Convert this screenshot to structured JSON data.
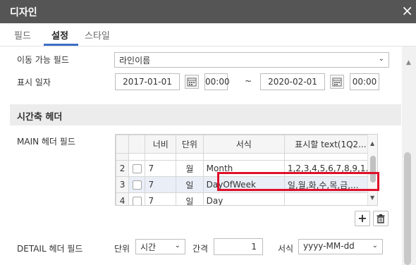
{
  "dialog": {
    "title": "디자인",
    "close_icon": "×"
  },
  "tabs": [
    {
      "label": "필드"
    },
    {
      "label": "설정"
    },
    {
      "label": "스타일"
    }
  ],
  "settings": {
    "movable_field": {
      "label": "이동 가능 필드",
      "value": "라인이름"
    },
    "display_date": {
      "label": "표시 일자",
      "start_date": "2017-01-01",
      "start_time": "00:00",
      "separator": "~",
      "end_date": "2020-02-01",
      "end_time": "00:00"
    }
  },
  "time_axis_header": {
    "title": "시간축 헤더"
  },
  "main_header": {
    "label": "MAIN 헤더 필드",
    "columns": [
      "너비",
      "단위",
      "서식",
      "표시할 text(1Q2..."
    ],
    "rows": [
      {
        "num": "2",
        "width": "7",
        "unit": "월",
        "format": "Month",
        "text": "1,2,3,4,5,6,7,8,9,1..."
      },
      {
        "num": "3",
        "width": "7",
        "unit": "일",
        "format": "DayOfWeek",
        "text": "일,월,화,수,목,금,..."
      },
      {
        "num": "4",
        "width": "7",
        "unit": "일",
        "format": "Day",
        "text": ""
      }
    ],
    "add_button": "+",
    "delete_icon": "trash-icon"
  },
  "detail_header": {
    "label": "DETAIL 헤더 필드",
    "unit_label": "단위",
    "unit_value": "시간",
    "interval_label": "간격",
    "interval_value": "1",
    "format_label": "서식",
    "format_value": "yyyy-MM-dd"
  },
  "colors": {
    "title_bar": "#555555",
    "accent": "#3b6fc6",
    "highlight_border": "#e0102a"
  }
}
